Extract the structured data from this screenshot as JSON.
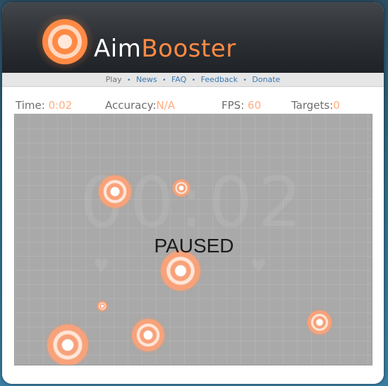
{
  "header": {
    "logo_icon": "concentric-target-icon",
    "logo_word_1": "Aim",
    "logo_word_2": "Booster",
    "brand_color": "#ff8a45"
  },
  "nav": {
    "items": [
      "Play",
      "News",
      "FAQ",
      "Feedback",
      "Donate"
    ],
    "separator": "•",
    "current": "Play"
  },
  "stats": {
    "time_label": "Time",
    "time_value": "0:02",
    "accuracy_label": "Accuracy",
    "accuracy_value": "N/A",
    "fps_label": "FPS",
    "fps_value": "60",
    "targets_label": "Targets",
    "targets_value": "0",
    "colon": ":",
    "value_color": "#ffad80"
  },
  "arena": {
    "background_timer": "00:02",
    "background_lives": "♥ ♥ ♥",
    "status": "PAUSED",
    "background_color": "#a9a9a9",
    "target_color": "#f7a27a"
  }
}
